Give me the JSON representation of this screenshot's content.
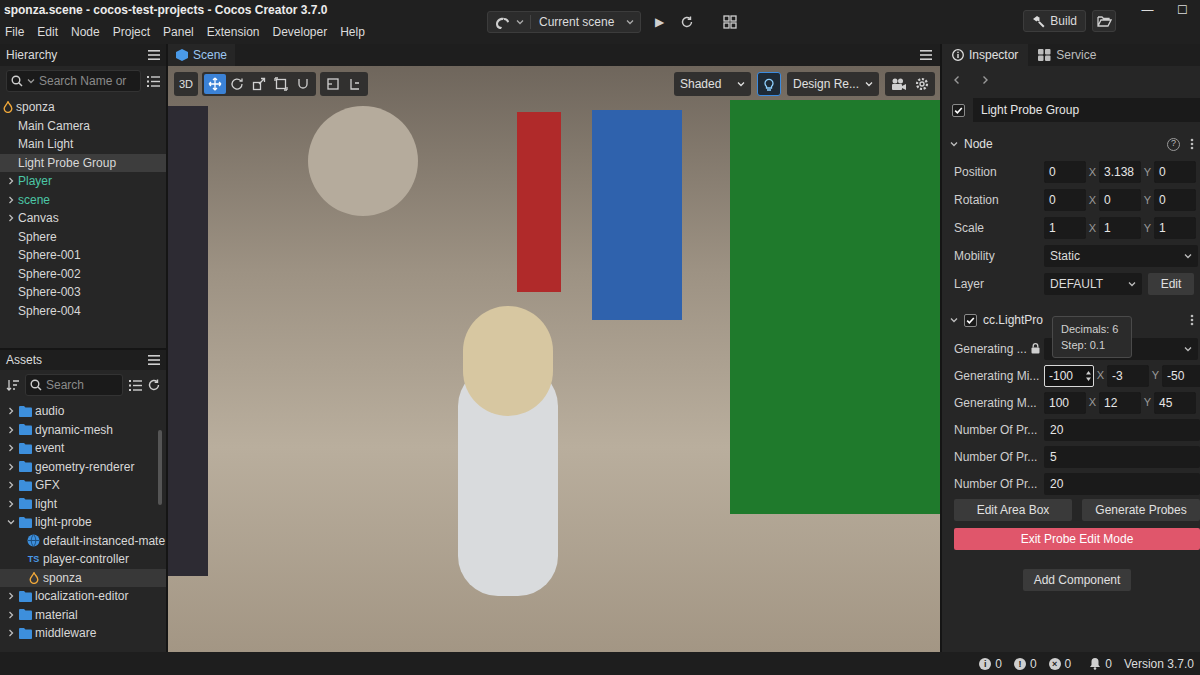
{
  "window": {
    "title": "sponza.scene - cocos-test-projects - Cocos Creator 3.7.0",
    "controls": [
      "—",
      "☐"
    ]
  },
  "menu": [
    "File",
    "Edit",
    "Node",
    "Project",
    "Panel",
    "Extension",
    "Developer",
    "Help"
  ],
  "toolbar": {
    "scene_select": "Current scene",
    "play": "▶",
    "build": "Build"
  },
  "hierarchy": {
    "title": "Hierarchy",
    "search": {
      "placeholder": "Search Name or"
    },
    "items": [
      {
        "label": "sponza",
        "depth": 0,
        "kind": "scene",
        "expandable": false,
        "selected": false
      },
      {
        "label": "Main Camera",
        "depth": 1,
        "kind": "node",
        "expandable": false,
        "selected": false
      },
      {
        "label": "Main Light",
        "depth": 1,
        "kind": "node",
        "expandable": false,
        "selected": false
      },
      {
        "label": "Light Probe Group",
        "depth": 1,
        "kind": "node",
        "expandable": false,
        "selected": true
      },
      {
        "label": "Player",
        "depth": 1,
        "kind": "prefab",
        "expandable": true,
        "expanded": false,
        "selected": false
      },
      {
        "label": "scene",
        "depth": 1,
        "kind": "prefab",
        "expandable": true,
        "expanded": false,
        "selected": false
      },
      {
        "label": "Canvas",
        "depth": 1,
        "kind": "node",
        "expandable": true,
        "expanded": false,
        "selected": false
      },
      {
        "label": "Sphere",
        "depth": 1,
        "kind": "node",
        "expandable": false,
        "selected": false
      },
      {
        "label": "Sphere-001",
        "depth": 1,
        "kind": "node",
        "expandable": false,
        "selected": false
      },
      {
        "label": "Sphere-002",
        "depth": 1,
        "kind": "node",
        "expandable": false,
        "selected": false
      },
      {
        "label": "Sphere-003",
        "depth": 1,
        "kind": "node",
        "expandable": false,
        "selected": false
      },
      {
        "label": "Sphere-004",
        "depth": 1,
        "kind": "node",
        "expandable": false,
        "selected": false
      }
    ]
  },
  "assets": {
    "title": "Assets",
    "search": {
      "placeholder": "Search"
    },
    "items": [
      {
        "label": "audio",
        "depth": 0,
        "kind": "folder",
        "expandable": true,
        "expanded": false,
        "selected": false
      },
      {
        "label": "dynamic-mesh",
        "depth": 0,
        "kind": "folder",
        "expandable": true,
        "expanded": false,
        "selected": false
      },
      {
        "label": "event",
        "depth": 0,
        "kind": "folder",
        "expandable": true,
        "expanded": false,
        "selected": false
      },
      {
        "label": "geometry-renderer",
        "depth": 0,
        "kind": "folder",
        "expandable": true,
        "expanded": false,
        "selected": false
      },
      {
        "label": "GFX",
        "depth": 0,
        "kind": "folder",
        "expandable": true,
        "expanded": false,
        "selected": false
      },
      {
        "label": "light",
        "depth": 0,
        "kind": "folder",
        "expandable": true,
        "expanded": false,
        "selected": false
      },
      {
        "label": "light-probe",
        "depth": 0,
        "kind": "folder",
        "expandable": true,
        "expanded": true,
        "selected": false
      },
      {
        "label": "default-instanced-mate",
        "depth": 1,
        "kind": "material",
        "expandable": false,
        "selected": false
      },
      {
        "label": "player-controller",
        "depth": 1,
        "kind": "script",
        "badge": "TS",
        "expandable": false,
        "selected": false
      },
      {
        "label": "sponza",
        "depth": 1,
        "kind": "scene",
        "expandable": false,
        "selected": true
      },
      {
        "label": "localization-editor",
        "depth": 0,
        "kind": "folder",
        "expandable": true,
        "expanded": false,
        "selected": false
      },
      {
        "label": "material",
        "depth": 0,
        "kind": "folder",
        "expandable": true,
        "expanded": false,
        "selected": false
      },
      {
        "label": "middleware",
        "depth": 0,
        "kind": "folder",
        "expandable": true,
        "expanded": false,
        "selected": false
      }
    ]
  },
  "scene": {
    "tab": {
      "label": "Scene",
      "selected": true
    },
    "mode": "3D",
    "tools": [
      {
        "selected": true
      },
      {
        "selected": false
      },
      {
        "selected": false
      },
      {
        "selected": false
      },
      {
        "selected": false
      },
      {
        "selected": false
      },
      {
        "selected": false
      }
    ],
    "shading": "Shaded",
    "lighting": {
      "on": true
    },
    "resolution": "Design Re..."
  },
  "inspector": {
    "tabs": [
      {
        "label": "Inspector",
        "selected": true
      },
      {
        "label": "Service",
        "selected": false
      }
    ],
    "node": {
      "name": "Light Probe Group",
      "enabled": true
    },
    "sections": [
      {
        "title": "Node",
        "expanded": true,
        "help": "?",
        "rows": [
          {
            "label": "Position",
            "kind": "vec3",
            "fields": [
              {
                "value": "0",
                "axis": "X",
                "focused": false
              },
              {
                "value": "3.138",
                "axis": "Y",
                "focused": false
              },
              {
                "value": "0",
                "focused": false
              }
            ]
          },
          {
            "label": "Rotation",
            "kind": "vec3",
            "fields": [
              {
                "value": "0",
                "axis": "X",
                "focused": false
              },
              {
                "value": "0",
                "axis": "Y",
                "focused": false
              },
              {
                "value": "0",
                "focused": false
              }
            ]
          },
          {
            "label": "Scale",
            "kind": "vec3",
            "fields": [
              {
                "value": "1",
                "axis": "X",
                "focused": false
              },
              {
                "value": "1",
                "axis": "Y",
                "focused": false
              },
              {
                "value": "1",
                "focused": false
              }
            ]
          },
          {
            "label": "Mobility",
            "kind": "select",
            "value": "Static"
          },
          {
            "label": "Layer",
            "kind": "select_button",
            "value": "DEFAULT",
            "button": "Edit"
          }
        ]
      },
      {
        "title": "cc.LightPro",
        "enabled": true,
        "expanded": true,
        "rows": [
          {
            "label": "Generating ...",
            "kind": "select_locked"
          },
          {
            "label": "Generating Mi...",
            "kind": "vec3",
            "fields": [
              {
                "value": "-100",
                "axis": "X",
                "focused": true
              },
              {
                "value": "-3",
                "axis": "Y",
                "focused": false
              },
              {
                "value": "-50",
                "focused": false
              }
            ]
          },
          {
            "label": "Generating M...",
            "kind": "vec3",
            "fields": [
              {
                "value": "100",
                "axis": "X",
                "focused": false
              },
              {
                "value": "12",
                "axis": "Y",
                "focused": false
              },
              {
                "value": "45",
                "focused": false
              }
            ]
          },
          {
            "label": "Number Of Pr...",
            "kind": "number",
            "value": "20"
          },
          {
            "label": "Number Of Pr...",
            "kind": "number",
            "value": "5"
          },
          {
            "label": "Number Of Pr...",
            "kind": "number",
            "value": "20"
          }
        ],
        "buttons": [
          "Edit Area Box",
          "Generate Probes"
        ],
        "exit_button": "Exit Probe Edit Mode"
      }
    ],
    "add_component": "Add Component",
    "tooltip": [
      "Decimals: 6",
      "Step: 0.1"
    ]
  },
  "status": {
    "counts": [
      {
        "glyph": "i",
        "count": "0"
      },
      {
        "glyph": "!",
        "count": "0"
      },
      {
        "glyph": "×",
        "count": "0"
      }
    ],
    "notifications": "0",
    "version": "Version 3.7.0"
  }
}
